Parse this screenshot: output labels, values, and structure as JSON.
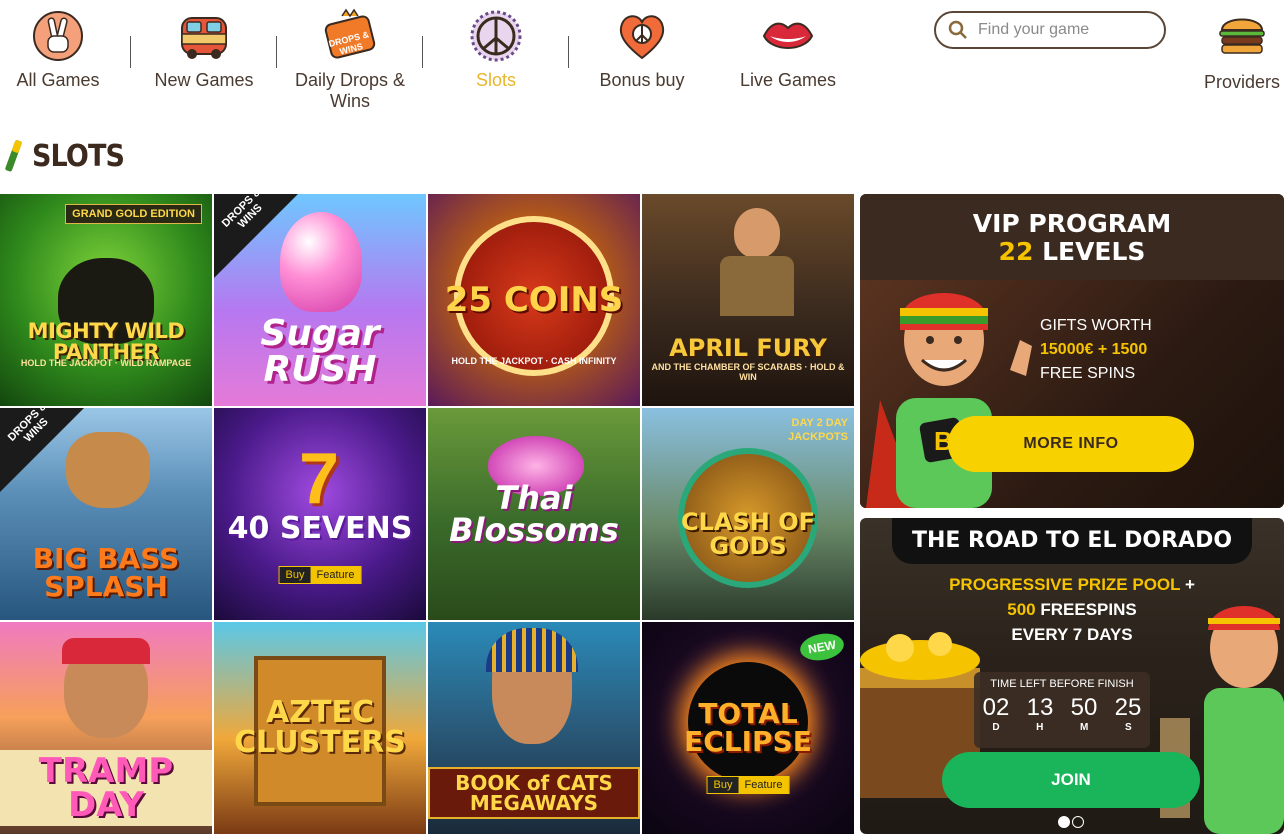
{
  "nav": {
    "items": [
      {
        "label": "All Games",
        "icon": "victory-hand-icon",
        "active": false
      },
      {
        "label": "New Games",
        "icon": "van-icon",
        "active": false
      },
      {
        "label": "Daily Drops & Wins",
        "icon": "drops-wins-icon",
        "active": false
      },
      {
        "label": "Slots",
        "icon": "peace-sign-icon",
        "active": true
      },
      {
        "label": "Bonus buy",
        "icon": "heart-peace-icon",
        "active": false
      },
      {
        "label": "Live Games",
        "icon": "lips-icon",
        "active": false
      }
    ],
    "drops_icon_text": "DROPS & WINS",
    "search_placeholder": "Find your game",
    "providers_label": "Providers",
    "active_color": "#e8b62a"
  },
  "section": {
    "title": "SLOTS"
  },
  "games": [
    {
      "title": "MIGHTY WILD PANTHER",
      "sub": "HOLD THE JACKPOT · WILD RAMPAGE",
      "corner": "GRAND GOLD EDITION"
    },
    {
      "title": "Sugar RUSH",
      "ribbon": "DROPS & WINS"
    },
    {
      "title": "25 COINS",
      "sub": "HOLD THE JACKPOT · CASH INFINITY"
    },
    {
      "title": "APRIL FURY",
      "sub": "AND THE CHAMBER OF SCARABS · HOLD & WIN"
    },
    {
      "title": "BIG BASS SPLASH",
      "ribbon": "DROPS & WINS"
    },
    {
      "title": "40 SEVENS",
      "buy": [
        "Buy",
        "Feature"
      ]
    },
    {
      "title": "Thai Blossoms"
    },
    {
      "title": "CLASH OF GODS",
      "corner": "DAY 2 DAY JACKPOTS"
    },
    {
      "title": "TRAMP DAY"
    },
    {
      "title": "AZTEC CLUSTERS"
    },
    {
      "title": "BOOK of CATS MEGAWAYS"
    },
    {
      "title": "TOTAL ECLIPSE",
      "buy": [
        "Buy",
        "Feature"
      ],
      "new": "NEW"
    }
  ],
  "vip": {
    "line1": "VIP PROGRAM",
    "levels_number": "22",
    "levels_word": "LEVELS",
    "gifts_line1": "GIFTS WORTH",
    "gifts_amount": "15000€ + 1500",
    "gifts_line3": "FREE SPINS",
    "button": "MORE INFO"
  },
  "eldorado": {
    "title": "THE ROAD TO EL DORADO",
    "prize_pool": "PROGRESSIVE PRIZE POOL",
    "plus": "+",
    "freespins_number": "500",
    "freespins_word": "FREESPINS",
    "every": "EVERY 7 DAYS",
    "timer_label": "TIME LEFT BEFORE FINISH",
    "timer": [
      {
        "value": "02",
        "unit": "D"
      },
      {
        "value": "13",
        "unit": "H"
      },
      {
        "value": "50",
        "unit": "M"
      },
      {
        "value": "25",
        "unit": "S"
      }
    ],
    "button": "JOIN"
  }
}
